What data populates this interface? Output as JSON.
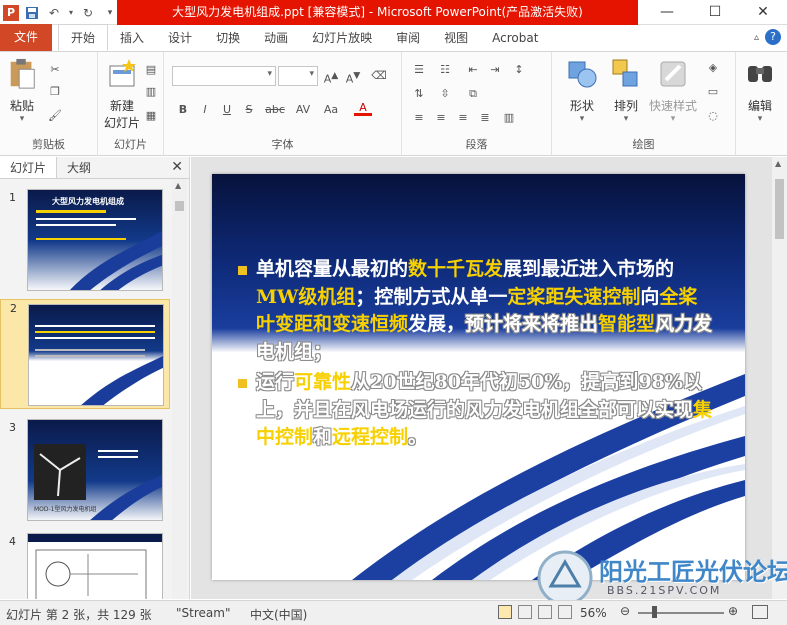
{
  "window": {
    "title": "大型风力发电机组成.ppt [兼容模式] - Microsoft PowerPoint(产品激活失败)",
    "app_icon": "P",
    "controls": {
      "minimize": "—",
      "maximize": "☐",
      "close": "✕"
    }
  },
  "ribbon_tabs": [
    "文件",
    "开始",
    "插入",
    "设计",
    "切换",
    "动画",
    "幻灯片放映",
    "审阅",
    "视图",
    "Acrobat"
  ],
  "ribbon": {
    "clipboard": {
      "paste": "粘贴",
      "group": "剪贴板"
    },
    "slides": {
      "new_slide_1": "新建",
      "new_slide_2": "幻灯片",
      "group": "幻灯片"
    },
    "font": {
      "bold": "B",
      "italic": "I",
      "underline": "U",
      "strike": "S",
      "shadow": "abc",
      "spacing": "AV",
      "case": "Aa",
      "color": "A",
      "group": "字体"
    },
    "paragraph": {
      "group": "段落"
    },
    "drawing": {
      "shapes": "形状",
      "arrange": "排列",
      "quick_styles": "快速样式",
      "group": "绘图"
    },
    "editing": {
      "label": "编辑"
    }
  },
  "left_pane": {
    "tabs": [
      "幻灯片",
      "大纲"
    ],
    "close": "✕",
    "thumbnails": [
      {
        "num": "1",
        "title": "大型风力发电机组成"
      },
      {
        "num": "2",
        "title": ""
      },
      {
        "num": "3",
        "caption": "MOD-1型风力发电机组"
      },
      {
        "num": "4",
        "title": ""
      }
    ]
  },
  "slide": {
    "bullet1": {
      "p1": "单机容量从最初的",
      "h1": "数十千瓦发",
      "p2": "展到最近进入市场的",
      "h2": "MW级机组",
      "p3": "；控制方式从单一",
      "h3": "定桨距失速控制",
      "p4": "向",
      "h4": "全桨叶变距和变速恒频",
      "p5": "发展，",
      "o1": "预计将来将推出",
      "h5": "智能型",
      "o2": "风力发电机组；"
    },
    "bullet2": {
      "o1": "运行",
      "h1": "可靠性",
      "o2": "从20世纪80年代初50%，提高到98%以上，并且在风电场运行的风力发电机组全部可以实现",
      "h2": "集中控制",
      "o3": "和",
      "h3": "远程控制",
      "o4": "。"
    }
  },
  "statusbar": {
    "slide_info": "幻灯片 第 2 张，共 129 张",
    "theme": "\"Stream\"",
    "language": "中文(中国)",
    "zoom": "56%"
  },
  "watermark": {
    "main": "阳光工匠光伏论坛",
    "url": "BBS.21SPV.COM"
  },
  "colors": {
    "accent_file": "#d24726",
    "title_red": "#e51400",
    "slide_navy": "#0a1a4a",
    "highlight": "#f7d000"
  }
}
